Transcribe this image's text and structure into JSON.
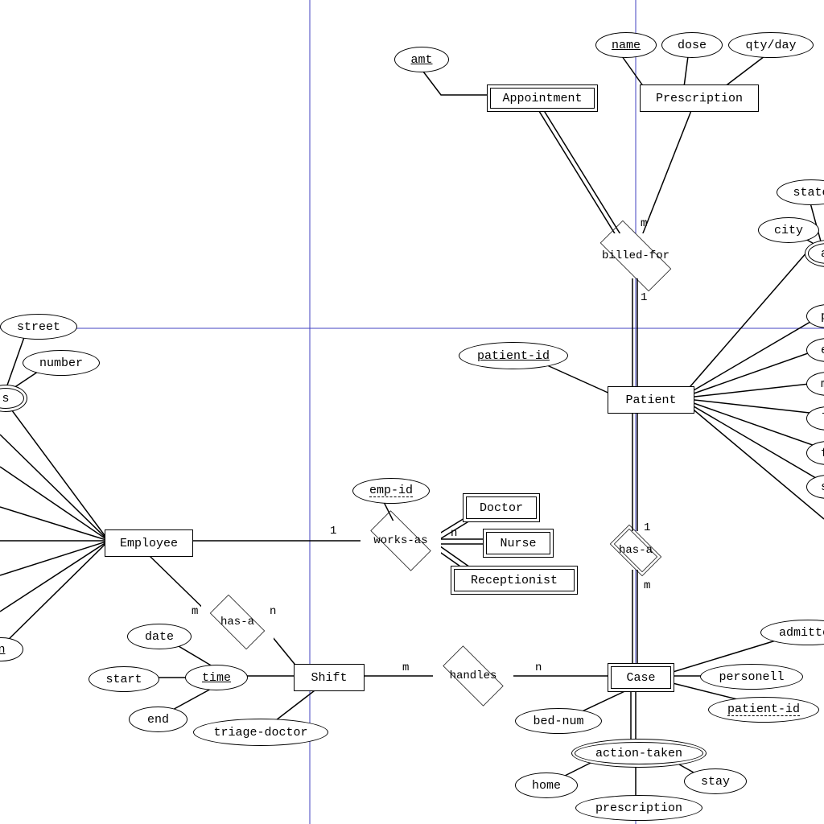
{
  "entities": {
    "appointment": "Appointment",
    "prescription": "Prescription",
    "patient": "Patient",
    "employee": "Employee",
    "doctor": "Doctor",
    "nurse": "Nurse",
    "receptionist": "Receptionist",
    "shift": "Shift",
    "case": "Case"
  },
  "relationships": {
    "billed_for": "billed-for",
    "works_as": "works-as",
    "has_a_emp": "has-a",
    "has_a_pat": "has-a",
    "handles": "handles"
  },
  "attributes": {
    "amt": "amt",
    "name": "name",
    "dose": "dose",
    "qty_day": "qty/day",
    "state": "state",
    "city": "city",
    "ad": "ad",
    "ph": "ph",
    "em": "em",
    "mi": "mi",
    "la": "la",
    "fi": "fi",
    "ss": "ss",
    "patient_id": "patient-id",
    "street": "street",
    "number": "number",
    "s": "s",
    "n": "n",
    "emp_id": "emp-id",
    "date": "date",
    "start": "start",
    "end": "end",
    "time": "time",
    "triage_doctor": "triage-doctor",
    "bed_num": "bed-num",
    "admitted": "admitted",
    "personell": "personell",
    "case_patient_id": "patient-id",
    "action_taken": "action-taken",
    "home": "home",
    "stay": "stay",
    "prescription_attr": "prescription"
  },
  "cardinalities": {
    "m1": "m",
    "one1": "1",
    "one2": "1",
    "n1": "n",
    "m2": "m",
    "n2": "n",
    "m3": "m",
    "n3": "n",
    "one3": "1",
    "m4": "m"
  }
}
